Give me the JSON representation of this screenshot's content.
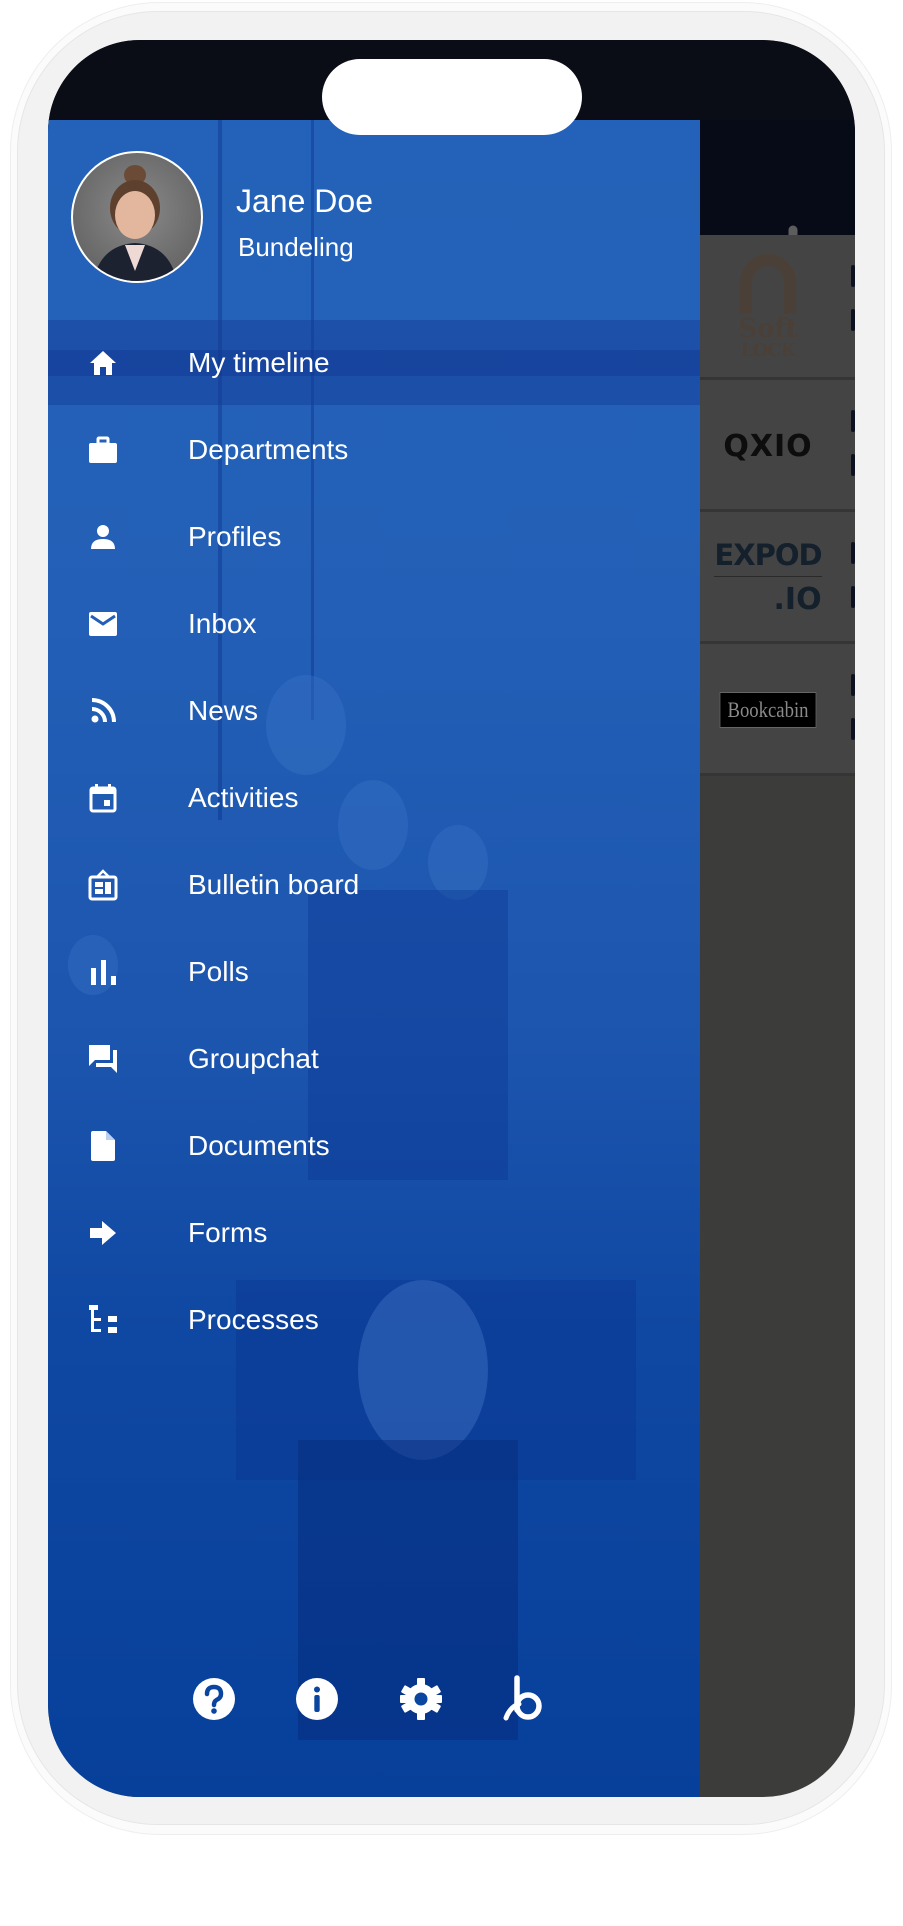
{
  "drawer": {
    "profile": {
      "name": "Jane Doe",
      "organization": "Bundeling",
      "avatar": "profile-photo"
    },
    "menu": [
      {
        "label": "My timeline",
        "icon": "home-icon",
        "active": true
      },
      {
        "label": "Departments",
        "icon": "briefcase-icon",
        "active": false
      },
      {
        "label": "Profiles",
        "icon": "person-icon",
        "active": false
      },
      {
        "label": "Inbox",
        "icon": "mail-icon",
        "active": false
      },
      {
        "label": "News",
        "icon": "rss-icon",
        "active": false
      },
      {
        "label": "Activities",
        "icon": "calendar-icon",
        "active": false
      },
      {
        "label": "Bulletin board",
        "icon": "bulletin-board-icon",
        "active": false
      },
      {
        "label": "Polls",
        "icon": "bar-chart-icon",
        "active": false
      },
      {
        "label": "Groupchat",
        "icon": "chat-icon",
        "active": false
      },
      {
        "label": "Documents",
        "icon": "document-icon",
        "active": false
      },
      {
        "label": "Forms",
        "icon": "arrow-right-icon",
        "active": false
      },
      {
        "label": "Processes",
        "icon": "hierarchy-icon",
        "active": false
      }
    ],
    "footer": [
      {
        "name": "help",
        "icon": "help-icon"
      },
      {
        "name": "info",
        "icon": "info-icon"
      },
      {
        "name": "settings",
        "icon": "gear-icon"
      },
      {
        "name": "brand",
        "icon": "bundeling-logo-icon"
      }
    ]
  },
  "background_app": {
    "header": {
      "back_icon": "chevron-left-icon",
      "logo_icon": "bundeling-logo-icon"
    },
    "list": [
      {
        "logo_text_line1": "Soft",
        "logo_text_line2": "LOCK"
      },
      {
        "logo_text": "QXIO"
      },
      {
        "logo_text_line1": "EXPOD",
        "logo_text_line2": ".IO"
      },
      {
        "logo_text": "Bookcabin"
      }
    ]
  },
  "colors": {
    "drawer_blue": "#235fb6",
    "drawer_blue_dark": "#07409a",
    "header_dark": "#070b18",
    "list_row_gray": "#444444",
    "overlay_gray": "#3c3c3a",
    "frame_gray": "#f2f2f2",
    "text_white": "#ffffff"
  }
}
